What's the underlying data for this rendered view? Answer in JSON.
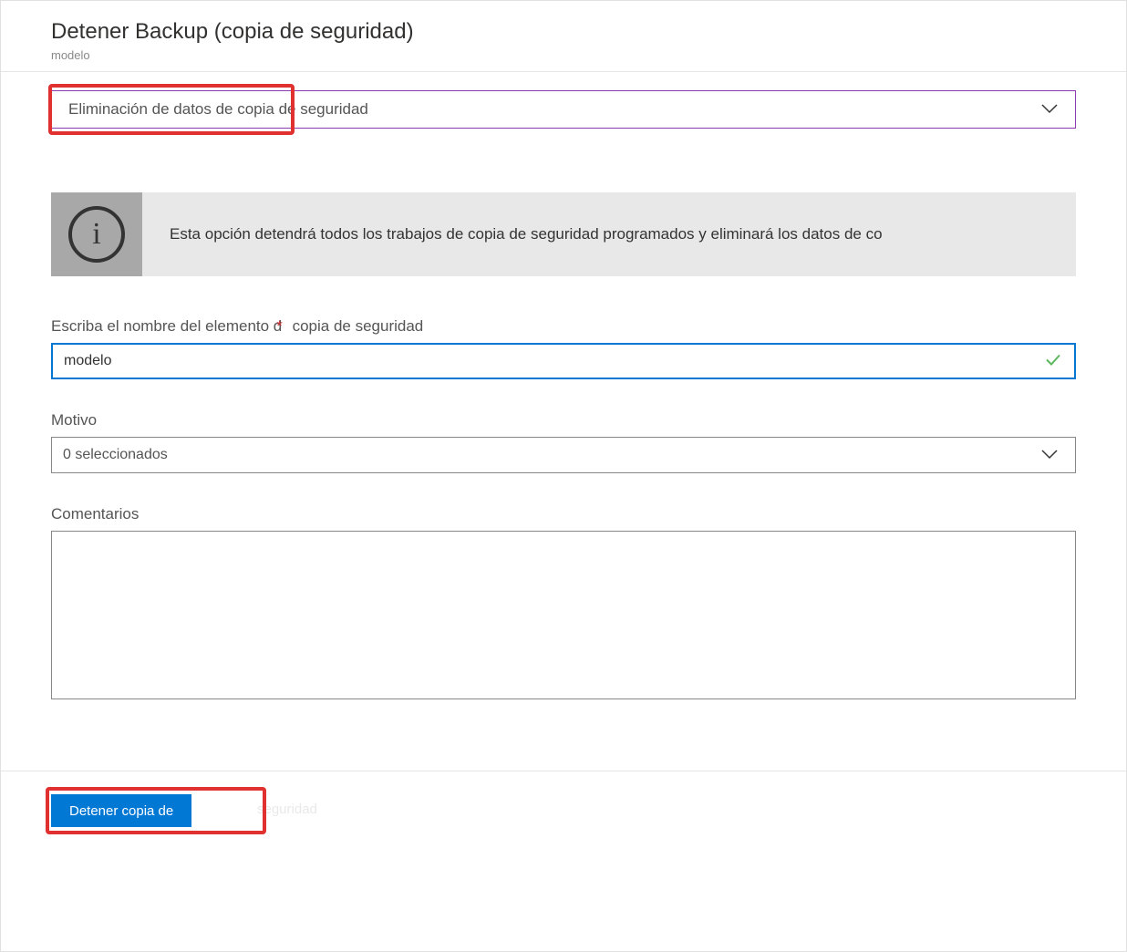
{
  "header": {
    "title": "Detener Backup (copia de seguridad)",
    "subtitle": "modelo"
  },
  "action_dropdown": {
    "selected": "Eliminación de datos de copia de seguridad"
  },
  "info_banner": {
    "text": "Esta opción detendrá todos los trabajos de copia de seguridad programados y eliminará los datos de co"
  },
  "name_field": {
    "label_part1": "Escriba el nombre del elemento d",
    "label_part2": " copia de seguridad",
    "required_mark": "*",
    "value": "modelo"
  },
  "reason_field": {
    "label": "Motivo",
    "selected": "0 seleccionados"
  },
  "comments_field": {
    "label": "Comentarios",
    "value": ""
  },
  "footer": {
    "button_label": "Detener copia de",
    "faded_text": "seguridad"
  }
}
